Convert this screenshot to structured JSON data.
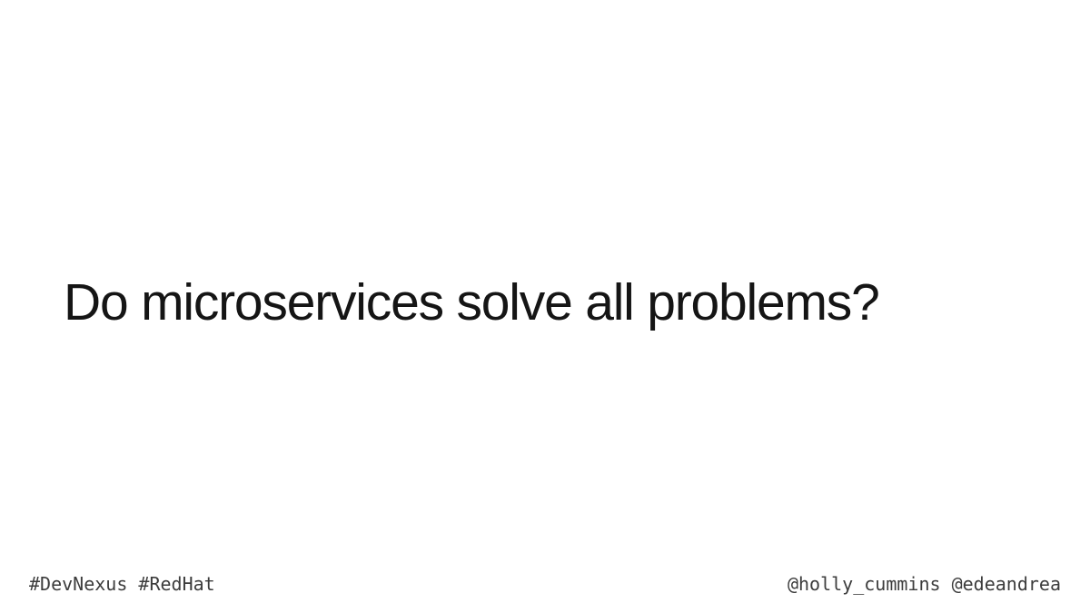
{
  "slide": {
    "headline": "Do microservices solve all problems?"
  },
  "footer": {
    "hashtags": "#DevNexus #RedHat",
    "handles": "@holly_cummins @edeandrea"
  }
}
